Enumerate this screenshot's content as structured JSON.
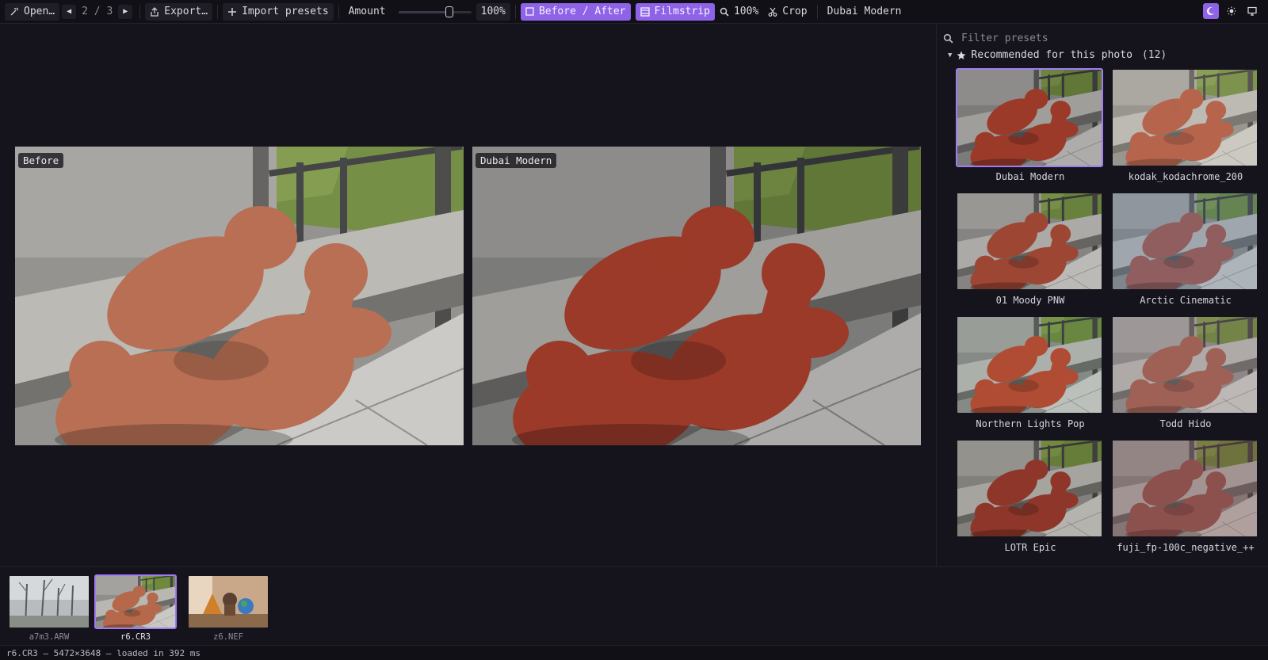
{
  "toolbar": {
    "open_label": "Open…",
    "prev_icon": "triangle-left-icon",
    "page_current": "2",
    "page_sep": "/",
    "page_total": "3",
    "next_icon": "triangle-right-icon",
    "export_label": "Export…",
    "import_label": "Import presets",
    "amount_label": "Amount",
    "amount_value": 1.0,
    "amount_pct": "100%",
    "before_after_label": "Before / After",
    "filmstrip_label": "Filmstrip",
    "zoom_label": "100%",
    "crop_label": "Crop",
    "active_preset": "Dubai Modern",
    "accent": "#8f63e8"
  },
  "viewer": {
    "before_label": "Before",
    "after_label": "Dubai Modern"
  },
  "panel": {
    "search_placeholder": "Filter presets",
    "section_title": "Recommended for this photo",
    "section_count": "(12)",
    "presets": [
      {
        "name": "Dubai Modern",
        "selected": true
      },
      {
        "name": "kodak_kodachrome_200",
        "selected": false
      },
      {
        "name": "01 Moody PNW",
        "selected": false
      },
      {
        "name": "Arctic Cinematic",
        "selected": false
      },
      {
        "name": "Northern Lights Pop",
        "selected": false
      },
      {
        "name": "Todd Hido",
        "selected": false
      },
      {
        "name": "LOTR Epic",
        "selected": false
      },
      {
        "name": "fuji_fp-100c_negative_++",
        "selected": false
      }
    ]
  },
  "filmstrip": {
    "items": [
      {
        "name": "a7m3.ARW",
        "selected": false
      },
      {
        "name": "r6.CR3",
        "selected": true
      },
      {
        "name": "z6.NEF",
        "selected": false
      }
    ]
  },
  "status": {
    "text": "r6.CR3 — 5472×3648 — loaded in 392 ms"
  }
}
